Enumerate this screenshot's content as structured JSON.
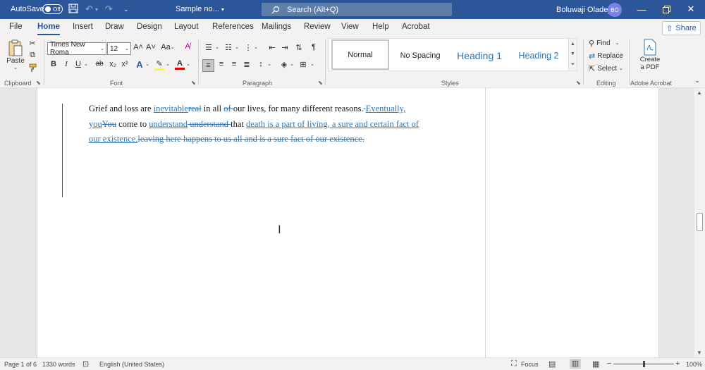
{
  "titlebar": {
    "autosave_label": "AutoSave",
    "autosave_state": "Off",
    "doc_title": "Sample no...",
    "search_placeholder": "Search (Alt+Q)",
    "user_name": "Boluwaji Oladeji",
    "user_initials": "BO"
  },
  "tabs": [
    "File",
    "Home",
    "Insert",
    "Draw",
    "Design",
    "Layout",
    "References",
    "Mailings",
    "Review",
    "View",
    "Help",
    "Acrobat"
  ],
  "active_tab": "Home",
  "share_label": "Share",
  "ribbon": {
    "clipboard": {
      "paste_label": "Paste",
      "group_label": "Clipboard"
    },
    "font": {
      "font_name": "Times New Roma",
      "font_size": "12",
      "group_label": "Font",
      "grow": "A˄",
      "shrink": "A˅",
      "case": "Aa",
      "bold": "B",
      "italic": "I",
      "underline": "U",
      "strike": "ab",
      "sub": "x₂",
      "sup": "x²",
      "effects": "A",
      "highlight": "✎",
      "font_color": "A"
    },
    "paragraph": {
      "group_label": "Paragraph"
    },
    "styles": {
      "group_label": "Styles",
      "items": [
        "Normal",
        "No Spacing",
        "Heading 1",
        "Heading 2"
      ]
    },
    "editing": {
      "group_label": "Editing",
      "find": "Find",
      "replace": "Replace",
      "select": "Select"
    },
    "acrobat": {
      "group_label": "Adobe Acrobat",
      "create_line1": "Create",
      "create_line2": "a PDF"
    }
  },
  "document": {
    "lines": [
      [
        {
          "t": "Grief and loss are ",
          "s": "normal"
        },
        {
          "t": "inevitable",
          "s": "ins"
        },
        {
          "t": "real",
          "s": "del"
        },
        {
          "t": " in all ",
          "s": "normal"
        },
        {
          "t": "of ",
          "s": "del"
        },
        {
          "t": "our lives, for many different reasons.",
          "s": "normal"
        },
        {
          "t": " ",
          "s": "del"
        },
        {
          "t": " Eventually,",
          "s": "ins"
        }
      ],
      [
        {
          "t": "you",
          "s": "ins"
        },
        {
          "t": "You",
          "s": "del"
        },
        {
          "t": " come to ",
          "s": "normal"
        },
        {
          "t": "understand",
          "s": "ins"
        },
        {
          "t": " understand ",
          "s": "del"
        },
        {
          "t": "that ",
          "s": "normal"
        },
        {
          "t": "death is a part of living, a sure and certain fact of",
          "s": "ins"
        }
      ],
      [
        {
          "t": "our existence.",
          "s": "ins"
        },
        {
          "t": "leaving here happens to us all and is a sure fact of our existence.",
          "s": "del"
        }
      ]
    ]
  },
  "statusbar": {
    "page": "Page 1 of 6",
    "words": "1330 words",
    "language": "English (United States)",
    "focus": "Focus",
    "zoom": "100%",
    "zoom_minus": "−",
    "zoom_plus": "+"
  },
  "colors": {
    "title_bar": "#2b579a",
    "revision": "#2e75b6",
    "heading_style": "#2e75b6"
  }
}
